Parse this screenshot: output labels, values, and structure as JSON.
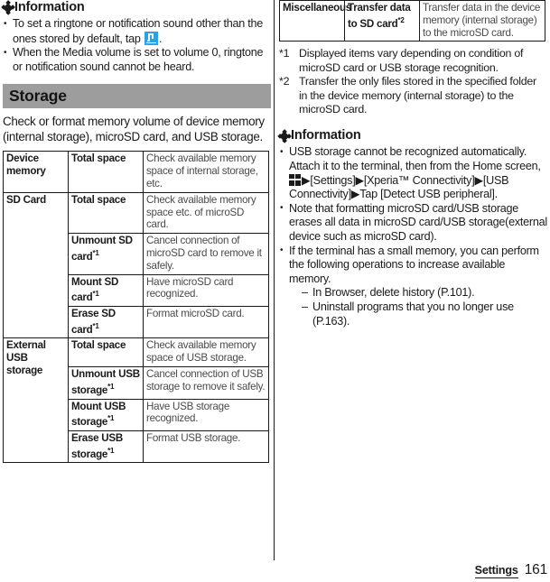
{
  "left": {
    "info1": {
      "heading": "Information",
      "bullets_pre": "To set a ringtone or notification sound other than the ones stored by default, tap ",
      "bullets_post": ".",
      "bullet2": "When the Media volume is set to volume 0, ringtone or notification sound cannot be heard.",
      "icon": "music-note-icon"
    },
    "section": {
      "title": "Storage",
      "intro": "Check or format memory volume of device memory (internal storage), microSD card, and USB storage."
    },
    "table": {
      "rows": [
        {
          "c1": "Device memory",
          "c2": "Total space",
          "c2sup": "",
          "c3": "Check available memory space of internal storage, etc."
        },
        {
          "c1": "SD Card",
          "c2": "Total space",
          "c2sup": "",
          "c3": "Check available memory space etc. of microSD card."
        },
        {
          "c1": "",
          "c2": "Unmount SD card",
          "c2sup": "*1",
          "c3": "Cancel connection of microSD card to remove it safely."
        },
        {
          "c1": "",
          "c2": "Mount SD card",
          "c2sup": "*1",
          "c3": "Have microSD card recognized."
        },
        {
          "c1": "",
          "c2": "Erase SD card",
          "c2sup": "*1",
          "c3": "Format microSD card."
        },
        {
          "c1": "External USB storage",
          "c2": "Total space",
          "c2sup": "",
          "c3": "Check available memory space of USB storage."
        },
        {
          "c1": "",
          "c2": "Unmount USB storage",
          "c2sup": "*1",
          "c3": "Cancel connection of USB storage to remove it safely."
        },
        {
          "c1": "",
          "c2": "Mount USB storage",
          "c2sup": "*1",
          "c3": "Have USB storage recognized."
        },
        {
          "c1": "",
          "c2": "Erase USB storage",
          "c2sup": "*1",
          "c3": "Format USB storage."
        }
      ]
    }
  },
  "right": {
    "table": {
      "rows": [
        {
          "c1": "Miscellaneous",
          "c2": "Transfer data to SD card",
          "c2sup": "*2",
          "c3": "Transfer data in the device memory (internal storage) to the microSD card."
        }
      ]
    },
    "footnotes": [
      {
        "mark": "*1",
        "text": "Displayed items vary depending on condition of microSD card or USB storage recognition."
      },
      {
        "mark": "*2",
        "text": "Transfer the only files stored in the specified folder in the device memory (internal storage) to the microSD card."
      }
    ],
    "info2": {
      "heading": "Information",
      "b1_part1": "USB storage cannot be recognized automatically. Attach it to the terminal, then from the Home screen, ",
      "b1_part2": "▶[Settings]▶[Xperia™ Connectivity]▶[USB Connectivity]▶Tap [Detect USB peripheral].",
      "b2": "Note that formatting microSD card/USB storage erases all data in microSD card/USB storage(external device such as microSD card).",
      "b3": "If the terminal has a small memory, you can perform the following operations to increase available memory.",
      "sub": [
        "In Browser, delete history (P.101).",
        "Uninstall programs that you no longer use (P.163)."
      ],
      "icon": "app-drawer-grid-icon"
    }
  },
  "footer": {
    "section": "Settings",
    "page": "161"
  },
  "colors": {
    "band": "#9d9d9d",
    "icon_blue": "#29a3e8",
    "text": "#1a1a1a",
    "muted": "#4a4a4a"
  }
}
